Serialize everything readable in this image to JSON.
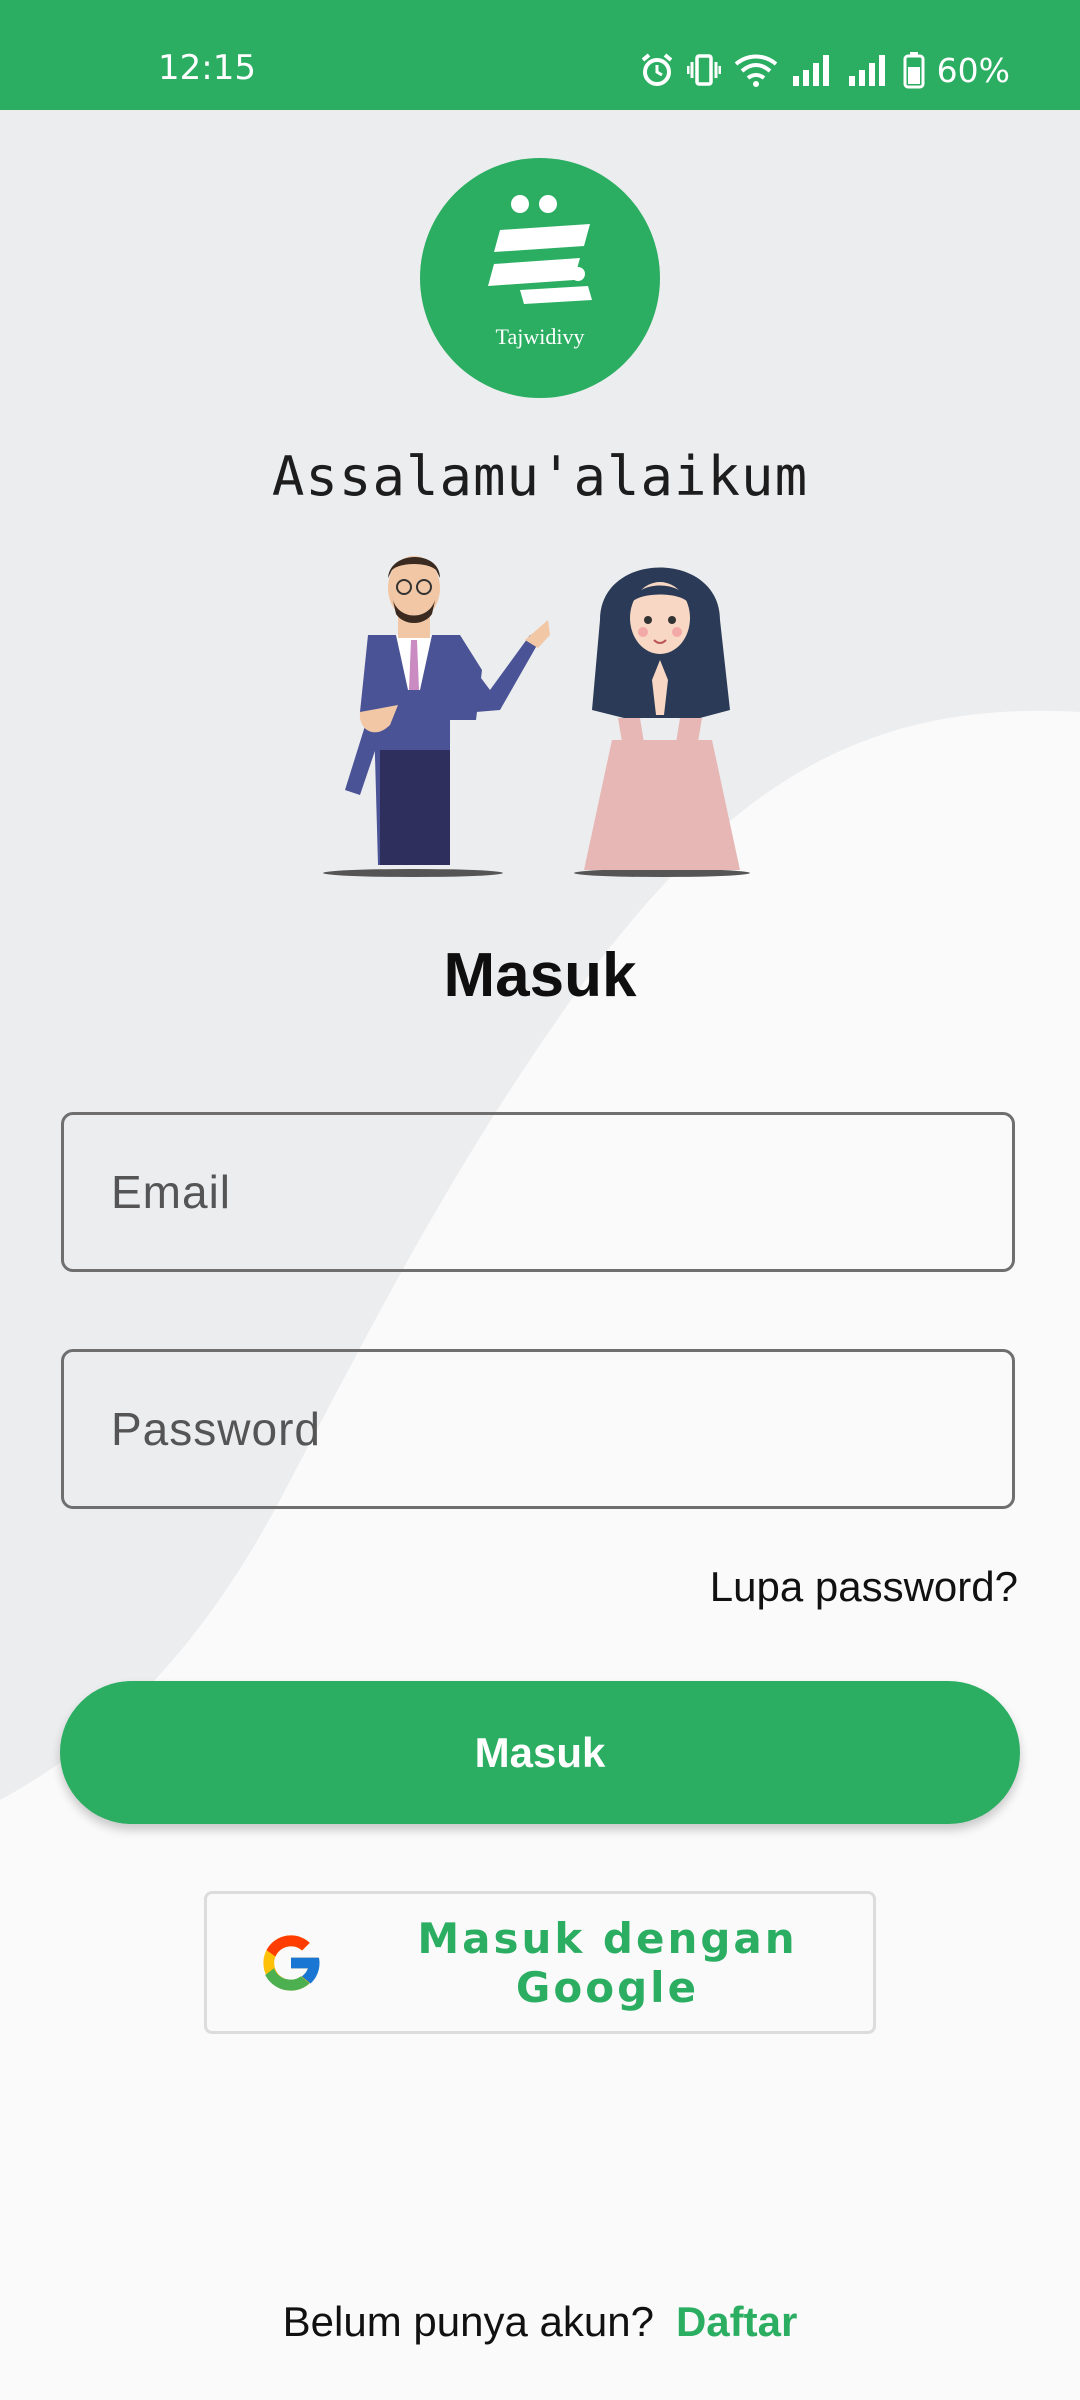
{
  "status_bar": {
    "time": "12:15",
    "battery_text": "60%",
    "icons": [
      "alarm-icon",
      "vibrate-icon",
      "wifi-icon",
      "signal-icon",
      "signal-icon",
      "battery-icon"
    ]
  },
  "brand": {
    "name": "Tajwidivy",
    "color": "#2bae62"
  },
  "greeting": "Assalamu'alaikum",
  "login": {
    "title": "Masuk",
    "email_placeholder": "Email",
    "password_placeholder": "Password",
    "forgot_label": "Lupa password?",
    "submit_label": "Masuk",
    "google_label": "Masuk dengan Google"
  },
  "signup": {
    "prompt": "Belum punya akun?",
    "link_label": "Daftar"
  }
}
